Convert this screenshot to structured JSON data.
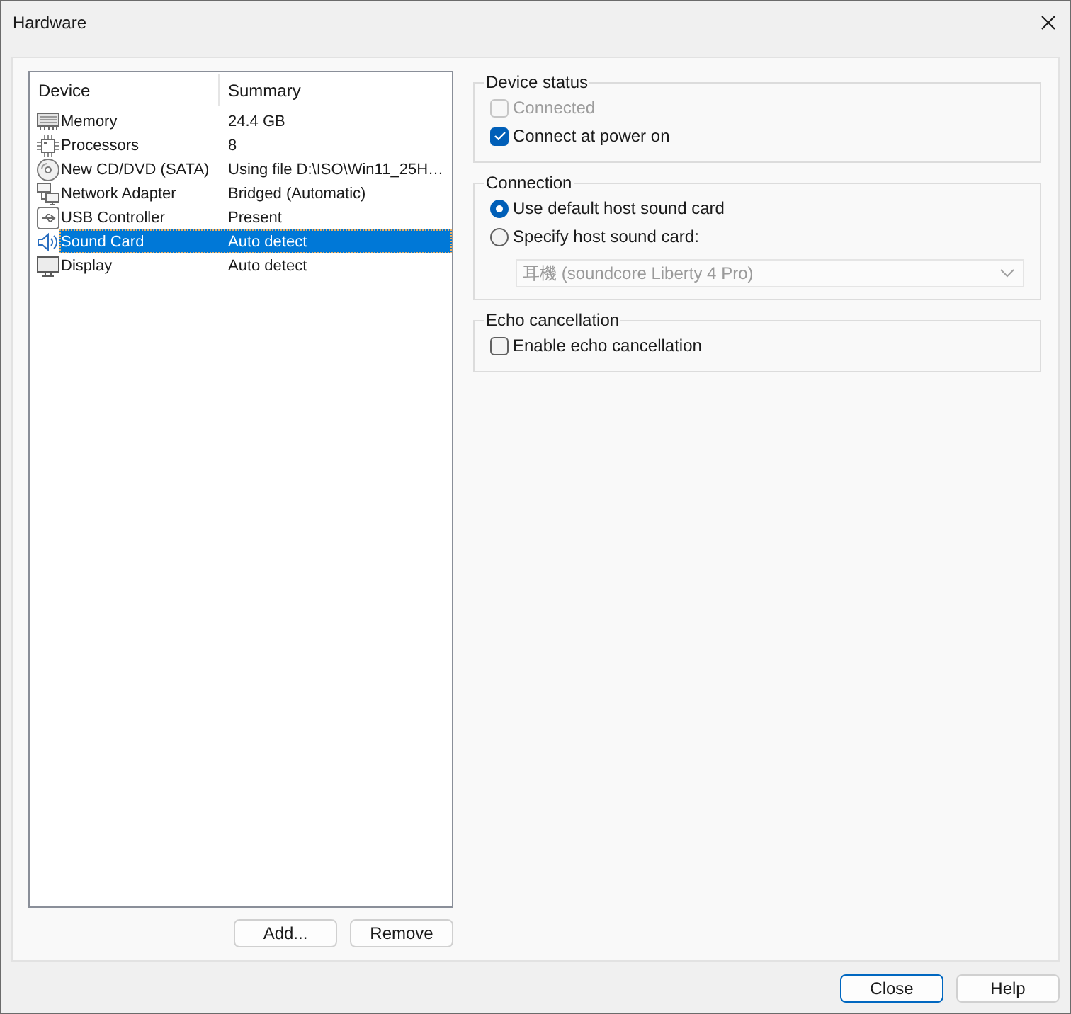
{
  "window": {
    "title": "Hardware"
  },
  "device_list": {
    "columns": [
      "Device",
      "Summary"
    ],
    "rows": [
      {
        "kind": "memory",
        "device": "Memory",
        "summary": "24.4 GB",
        "selected": false
      },
      {
        "kind": "processor",
        "device": "Processors",
        "summary": "8",
        "selected": false
      },
      {
        "kind": "cd",
        "device": "New CD/DVD (SATA)",
        "summary": "Using file D:\\ISO\\Win11_25H…",
        "selected": false
      },
      {
        "kind": "network",
        "device": "Network Adapter",
        "summary": "Bridged (Automatic)",
        "selected": false
      },
      {
        "kind": "usb",
        "device": "USB Controller",
        "summary": "Present",
        "selected": false
      },
      {
        "kind": "sound",
        "device": "Sound Card",
        "summary": "Auto detect",
        "selected": true
      },
      {
        "kind": "display",
        "device": "Display",
        "summary": "Auto detect",
        "selected": false
      }
    ]
  },
  "list_buttons": [
    "Add...",
    "Remove"
  ],
  "device_status": {
    "title": "Device status",
    "options": [
      {
        "label": "Connected",
        "checked": false,
        "disabled": true
      },
      {
        "label": "Connect at power on",
        "checked": true,
        "disabled": false
      }
    ]
  },
  "connection": {
    "title": "Connection",
    "options": [
      {
        "label": "Use default host sound card",
        "selected": true
      },
      {
        "label": "Specify host sound card:",
        "selected": false
      }
    ],
    "host_sound_card": {
      "value": "耳機 (soundcore Liberty 4 Pro)",
      "disabled": true
    }
  },
  "echo_cancellation": {
    "title": "Echo cancellation",
    "options": [
      {
        "label": "Enable echo cancellation",
        "checked": false,
        "disabled": false
      }
    ]
  },
  "dialog_buttons": [
    {
      "label": "Close",
      "focused": true
    },
    {
      "label": "Help",
      "focused": false
    }
  ]
}
